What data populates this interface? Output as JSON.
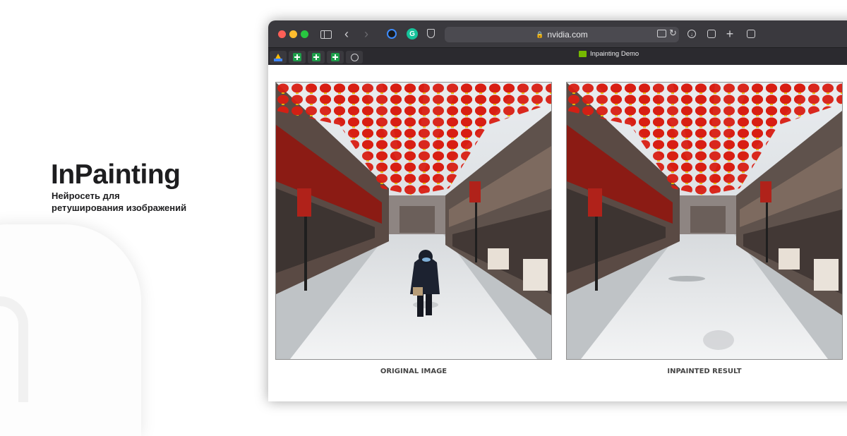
{
  "promo": {
    "title": "InPainting",
    "subtitle": "Нейросеть для ретуширования изображений"
  },
  "browser": {
    "url": "nvidia.com",
    "active_tab": "Inpainting Demo",
    "pinned_tabs": [
      "google-drive-icon",
      "sheets-icon",
      "sheets-icon",
      "sheets-icon",
      "safari-compass-icon"
    ]
  },
  "page": {
    "left_caption": "ORIGINAL IMAGE",
    "right_caption": "INPAINTED RESULT"
  },
  "colors": {
    "lantern_red": "#d81e13",
    "toolbar": "#3a393e",
    "nvidia_green": "#76b900"
  }
}
